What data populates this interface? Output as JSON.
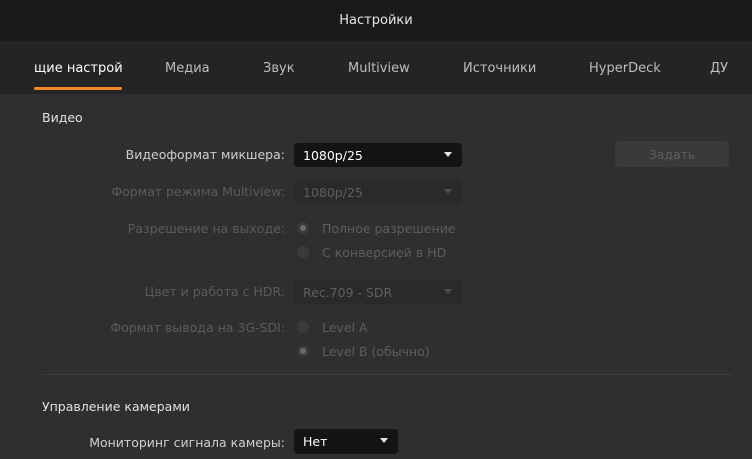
{
  "window": {
    "title": "Настройки"
  },
  "tabs": [
    {
      "label": "щие настрой"
    },
    {
      "label": "Медиа"
    },
    {
      "label": "Звук"
    },
    {
      "label": "Multiview"
    },
    {
      "label": "Источники"
    },
    {
      "label": "HyperDeck"
    },
    {
      "label": "ДУ"
    }
  ],
  "video": {
    "section_title": "Видео",
    "mixer_format": {
      "label": "Видеоформат микшера:",
      "value": "1080p/25",
      "button": "Задать"
    },
    "multiview_format": {
      "label": "Формат режима Multiview:",
      "value": "1080p/25"
    },
    "output_resolution": {
      "label": "Разрешение на выходе:",
      "options": [
        "Полное разрешение",
        "С конверсией в HD"
      ],
      "selected": "Полное разрешение"
    },
    "hdr": {
      "label": "Цвет и работа с HDR:",
      "value": "Rec.709 - SDR"
    },
    "sdi_3g": {
      "label": "Формат вывода на 3G-SDI:",
      "options": [
        "Level A",
        "Level B (обычно)"
      ],
      "selected": "Level B (обычно)"
    }
  },
  "camera_control": {
    "section_title": "Управление камерами",
    "monitoring": {
      "label": "Мониторинг сигнала камеры:",
      "value": "Нет"
    }
  },
  "colors": {
    "accent": "#f28a2a",
    "background": "#2f2f2f",
    "titlebar": "#1a1a1a",
    "tabbar": "#242424"
  }
}
